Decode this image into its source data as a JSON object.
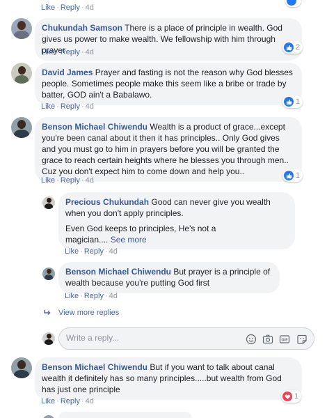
{
  "top_actions": {
    "like": "Like",
    "reply": "Reply",
    "time": "4d"
  },
  "comments": [
    {
      "author": "Chukundah Samson",
      "text": "There is a place of principle in wealth. God gives us power to make wealth. We fellowship with him through prayer",
      "like": "Like",
      "reply": "Reply",
      "time": "4d",
      "reaction_count": "2"
    },
    {
      "author": "David James",
      "text": "Prayer and fasting is not the reason why God blesses people. Sometimes people make this seem like a bribe or trade by batter, GOD ain't a Babalawo.",
      "like": "Like",
      "reply": "Reply",
      "time": "4d",
      "reaction_count": "1"
    },
    {
      "author": "Benson Michael Chiwendu",
      "text": "Wealth is a product of grace...except you're been canal about it then it has principles.. Only God gives and you must go to him in prayers before you will be granted the grace to reach certain heights where he blesses you through men.. Cuz you don't expect him to come down and help you..",
      "like": "Like",
      "reply": "Reply",
      "time": "4d",
      "reaction_count": "1"
    }
  ],
  "replies": [
    {
      "author": "Precious Chukundah",
      "text": "Good can never give you wealth when you don't apply principles.",
      "text2": "Even God keeps to principles, He's not a magician....",
      "see_more": "See more",
      "like": "Like",
      "reply": "Reply",
      "time": "4d"
    },
    {
      "author": "Benson Michael Chiwendu",
      "text": "But prayer is a principle of wealth because you're putting God first",
      "like": "Like",
      "reply": "Reply",
      "time": "4d"
    }
  ],
  "view_more_replies": "View more replies",
  "reply_input": {
    "placeholder": "Write a reply..."
  },
  "input_icons": [
    "emoji-icon",
    "camera-icon",
    "gif-icon",
    "sticker-icon"
  ],
  "last_comment": {
    "author": "Benson Michael Chiwendu",
    "text": "But if you want to talk about canal wealth it definitely has so many principles.....but wealth from God has just one principle",
    "like": "Like",
    "reply": "Reply",
    "time": "4d",
    "reaction_count": "1"
  },
  "colors": {
    "author": "#385898",
    "like_blue": "#2078f4",
    "love_red": "#f33e58",
    "bubble": "#f2f3f5"
  }
}
